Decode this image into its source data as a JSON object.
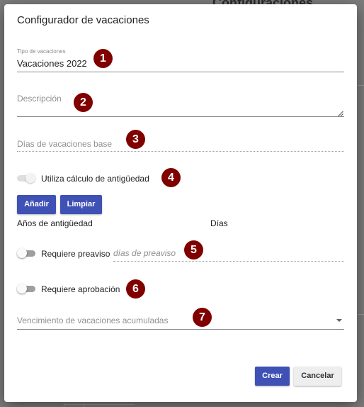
{
  "backdrop": {
    "title": "Configuraciones"
  },
  "dialog": {
    "title": "Configurador de vacaciones",
    "tipo": {
      "label": "Tipo de vacaciones",
      "value": "Vacaciones 2022"
    },
    "descripcion": {
      "placeholder": "Descripción"
    },
    "dias_base": {
      "placeholder": "Días de vacaciones base"
    },
    "antiguedad": {
      "label": "Utiliza cálculo de antigüedad",
      "enabled": false
    },
    "buttons": {
      "anadir": "Añadir",
      "limpiar": "Limpiar"
    },
    "table": {
      "col_anios": "Años de antigüedad",
      "col_dias": "Días"
    },
    "preaviso": {
      "label": "Requiere preaviso",
      "placeholder": "días de preaviso",
      "enabled": false
    },
    "aprobacion": {
      "label": "Requiere aprobación",
      "enabled": false
    },
    "vencimiento": {
      "placeholder": "Vencimiento de vacaciones acumuladas"
    },
    "actions": {
      "crear": "Crear",
      "cancelar": "Cancelar"
    }
  },
  "badges": [
    "1",
    "2",
    "3",
    "4",
    "5",
    "6",
    "7"
  ],
  "colors": {
    "primary": "#3f51b5",
    "badge": "#800000"
  },
  "icons": {
    "dropdown": "caret-down-icon",
    "resize": "resize-handle-icon"
  }
}
